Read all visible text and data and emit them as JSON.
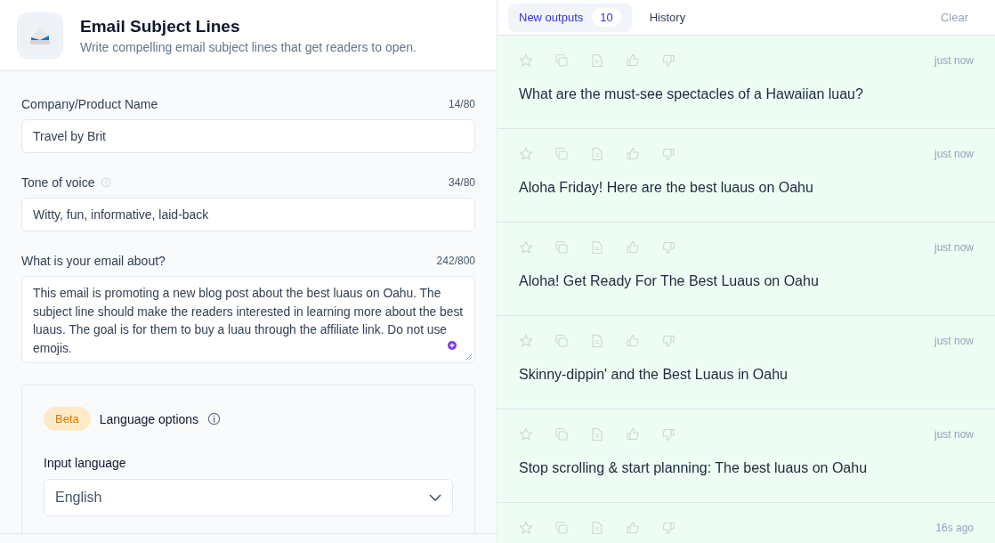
{
  "header": {
    "title": "Email Subject Lines",
    "subtitle": "Write compelling email subject lines that get readers to open."
  },
  "fields": [
    {
      "kind": "input",
      "label": "Company/Product Name",
      "info": false,
      "count": "14/80",
      "value": "Travel by Brit"
    },
    {
      "kind": "input",
      "label": "Tone of voice",
      "info": true,
      "count": "34/80",
      "value": "Witty, fun, informative, laid-back"
    },
    {
      "kind": "textarea",
      "label": "What is your email about?",
      "info": false,
      "count": "242/800",
      "value": "This email is promoting a new blog post about the best luaus on Oahu. The subject line should make the readers interested in learning more about the best luaus. The goal is for them to buy a luau through the affiliate link. Do not use emojis."
    }
  ],
  "language_options": {
    "badge": "Beta",
    "title": "Language options",
    "input_label": "Input language",
    "input_value": "English"
  },
  "tabs": [
    {
      "label": "New outputs",
      "count": "10",
      "selected": true
    },
    {
      "label": "History",
      "selected": false
    }
  ],
  "clear": "Clear",
  "outputs": [
    {
      "time": "just now",
      "text": "What are the must-see spectacles of a Hawaiian luau?"
    },
    {
      "time": "just now",
      "text": "Aloha Friday! Here are the best luaus on Oahu"
    },
    {
      "time": "just now",
      "text": "Aloha! Get Ready For The Best Luaus on Oahu"
    },
    {
      "time": "just now",
      "text": "Skinny-dippin' and the Best Luaus in Oahu"
    },
    {
      "time": "just now",
      "text": "Stop scrolling & start planning: The best luaus on Oahu"
    },
    {
      "time": "16s ago"
    }
  ]
}
